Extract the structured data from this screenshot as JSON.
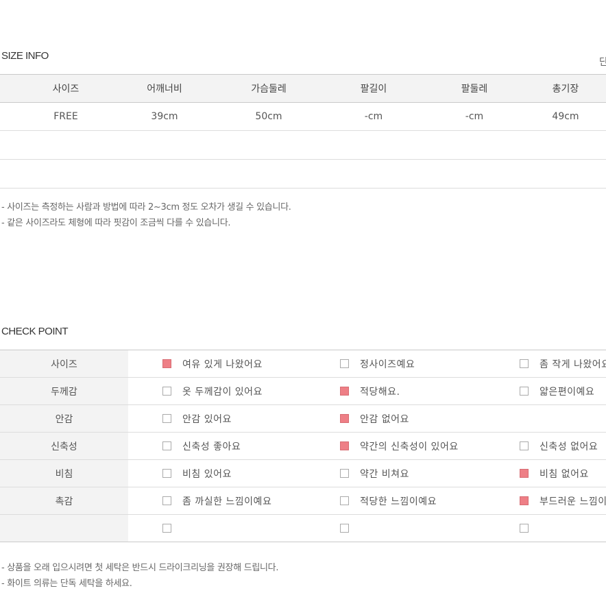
{
  "size_info": {
    "title": "SIZE INFO",
    "unit_label": "단",
    "headers": [
      "사이즈",
      "어깨너비",
      "가슴둘레",
      "팔길이",
      "팔둘레",
      "총기장"
    ],
    "rows": [
      [
        "FREE",
        "39cm",
        "50cm",
        "-cm",
        "-cm",
        "49cm"
      ]
    ],
    "notes": [
      "- 사이즈는 측정하는 사람과 방법에 따라 2~3cm 정도 오차가 생길 수 있습니다.",
      "- 같은 사이즈라도 체형에 따라 핏감이 조금씩 다를 수 있습니다."
    ]
  },
  "check_point": {
    "title": "CHECK POINT",
    "rows": [
      {
        "label": "사이즈",
        "options": [
          {
            "text": "여유 있게 나왔어요",
            "checked": true
          },
          {
            "text": "정사이즈예요",
            "checked": false
          },
          {
            "text": "좀 작게 나왔어요",
            "checked": false
          }
        ]
      },
      {
        "label": "두께감",
        "options": [
          {
            "text": "옷 두께감이 있어요",
            "checked": false
          },
          {
            "text": "적당해요.",
            "checked": true
          },
          {
            "text": "얇은편이예요",
            "checked": false
          }
        ]
      },
      {
        "label": "안감",
        "options": [
          {
            "text": "안감 있어요",
            "checked": false
          },
          {
            "text": "안감 없어요",
            "checked": true
          },
          null
        ]
      },
      {
        "label": "신축성",
        "options": [
          {
            "text": "신축성 좋아요",
            "checked": false
          },
          {
            "text": "약간의 신축성이 있어요",
            "checked": true
          },
          {
            "text": "신축성 없어요",
            "checked": false
          }
        ]
      },
      {
        "label": "비침",
        "options": [
          {
            "text": "비침 있어요",
            "checked": false
          },
          {
            "text": "약간 비쳐요",
            "checked": false
          },
          {
            "text": "비침 없어요",
            "checked": true
          }
        ]
      },
      {
        "label": "촉감",
        "options": [
          {
            "text": "좀 까실한 느낌이예요",
            "checked": false
          },
          {
            "text": "적당한 느낌이예요",
            "checked": false
          },
          {
            "text": "부드러운 느낌이예요",
            "checked": true
          }
        ]
      },
      {
        "label": "",
        "options": [
          {
            "text": "",
            "checked": false
          },
          {
            "text": "",
            "checked": false
          },
          {
            "text": "",
            "checked": false
          }
        ]
      }
    ],
    "notes": [
      "- 상품을 오래 입으시려면 첫 세탁은 반드시 드라이크리닝을 권장해 드립니다.",
      "- 화이트 의류는 단독 세탁을 하세요."
    ]
  }
}
